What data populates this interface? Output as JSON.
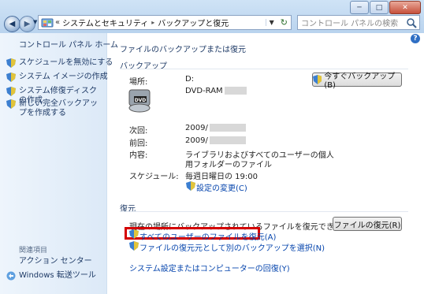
{
  "window": {
    "buttons": [
      "─",
      "□",
      "✕"
    ]
  },
  "nav": {
    "breadcrumb": [
      "«",
      "システムとセキュリティ",
      "バックアップと復元"
    ],
    "search_placeholder": "コントロール パネルの検索"
  },
  "sidebar": {
    "home": "コントロール パネル ホーム",
    "items": [
      "スケジュールを無効にする",
      "システム イメージの作成",
      "システム修復ディスクの作成",
      "新しい完全バックアップを作成する"
    ],
    "related_title": "関連項目",
    "related": [
      "アクション センター",
      "Windows 転送ツール"
    ]
  },
  "main": {
    "title": "ファイルのバックアップまたは復元",
    "backup_heading": "バックアップ",
    "location_label": "場所:",
    "location_drive": "D:",
    "location_media": "DVD-RAM",
    "backup_now_button": "今すぐバックアップ(B)",
    "next_label": "次回:",
    "next_value": "2009/",
    "last_label": "前回:",
    "last_value": "2009/",
    "contents_label": "内容:",
    "contents_value_line1": "ライブラリおよびすべてのユーザーの個人",
    "contents_value_line2": "用フォルダーのファイル",
    "schedule_label": "スケジュール:",
    "schedule_value": "毎週日曜日の 19:00",
    "change_settings_link": "設定の変更(C)",
    "restore_heading": "復元",
    "restore_text": "現在の場所にバックアップされているファイルを復元できます。",
    "restore_files_button": "ファイルの復元(R)",
    "restore_all_users_link": "すべてのユーザーのファイルを復元(A)",
    "select_other_backup_link": "ファイルの復元元として別のバックアップを選択(N)",
    "recover_system_link": "システム設定またはコンピューターの回復(Y)"
  },
  "colors": {
    "highlight_border": "#d40000",
    "link": "#0645ad",
    "sidebar_bg": "#e6f0fa"
  }
}
